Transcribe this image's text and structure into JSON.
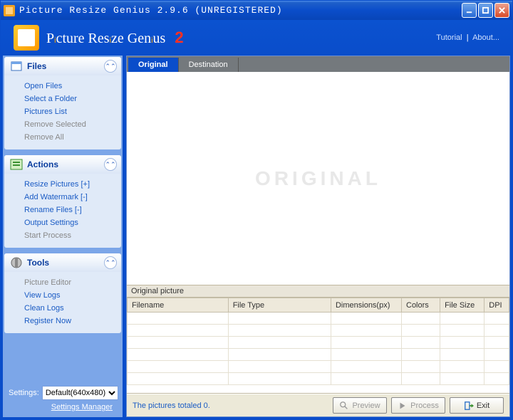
{
  "window": {
    "title": "Picture Resize Genius 2.9.6 (UNREGISTERED)"
  },
  "header": {
    "brand_html": "P<i>i</i>cture Res<i>i</i>ze Gen<i>i</i>us",
    "version_badge": "2",
    "links": {
      "tutorial": "Tutorial",
      "sep": "|",
      "about": "About..."
    }
  },
  "sidebar": {
    "panels": [
      {
        "id": "files",
        "title": "Files",
        "items": [
          {
            "label": "Open Files",
            "disabled": false
          },
          {
            "label": "Select a Folder",
            "disabled": false
          },
          {
            "label": "Pictures List",
            "disabled": false
          },
          {
            "label": "Remove Selected",
            "disabled": true
          },
          {
            "label": "Remove All",
            "disabled": true
          }
        ]
      },
      {
        "id": "actions",
        "title": "Actions",
        "items": [
          {
            "label": "Resize Pictures [+]",
            "disabled": false
          },
          {
            "label": "Add Watermark [-]",
            "disabled": false
          },
          {
            "label": "Rename Files [-]",
            "disabled": false
          },
          {
            "label": "Output Settings",
            "disabled": false
          },
          {
            "label": "Start Process",
            "disabled": true
          }
        ]
      },
      {
        "id": "tools",
        "title": "Tools",
        "items": [
          {
            "label": "Picture Editor",
            "disabled": true
          },
          {
            "label": "View Logs",
            "disabled": false
          },
          {
            "label": "Clean Logs",
            "disabled": false
          },
          {
            "label": "Register Now",
            "disabled": false
          }
        ]
      }
    ],
    "settings_label": "Settings:",
    "settings_value": "Default(640x480)",
    "settings_manager": "Settings Manager"
  },
  "tabs": {
    "original": "Original",
    "destination": "Destination"
  },
  "preview": {
    "watermark": "ORIGINAL"
  },
  "grid": {
    "caption": "Original picture",
    "columns": [
      "Filename",
      "File Type",
      "Dimensions(px)",
      "Colors",
      "File Size",
      "DPI"
    ],
    "rows": []
  },
  "status": {
    "text": "The pictures totaled 0.",
    "preview_btn": "Preview",
    "process_btn": "Process",
    "exit_btn": "Exit"
  }
}
